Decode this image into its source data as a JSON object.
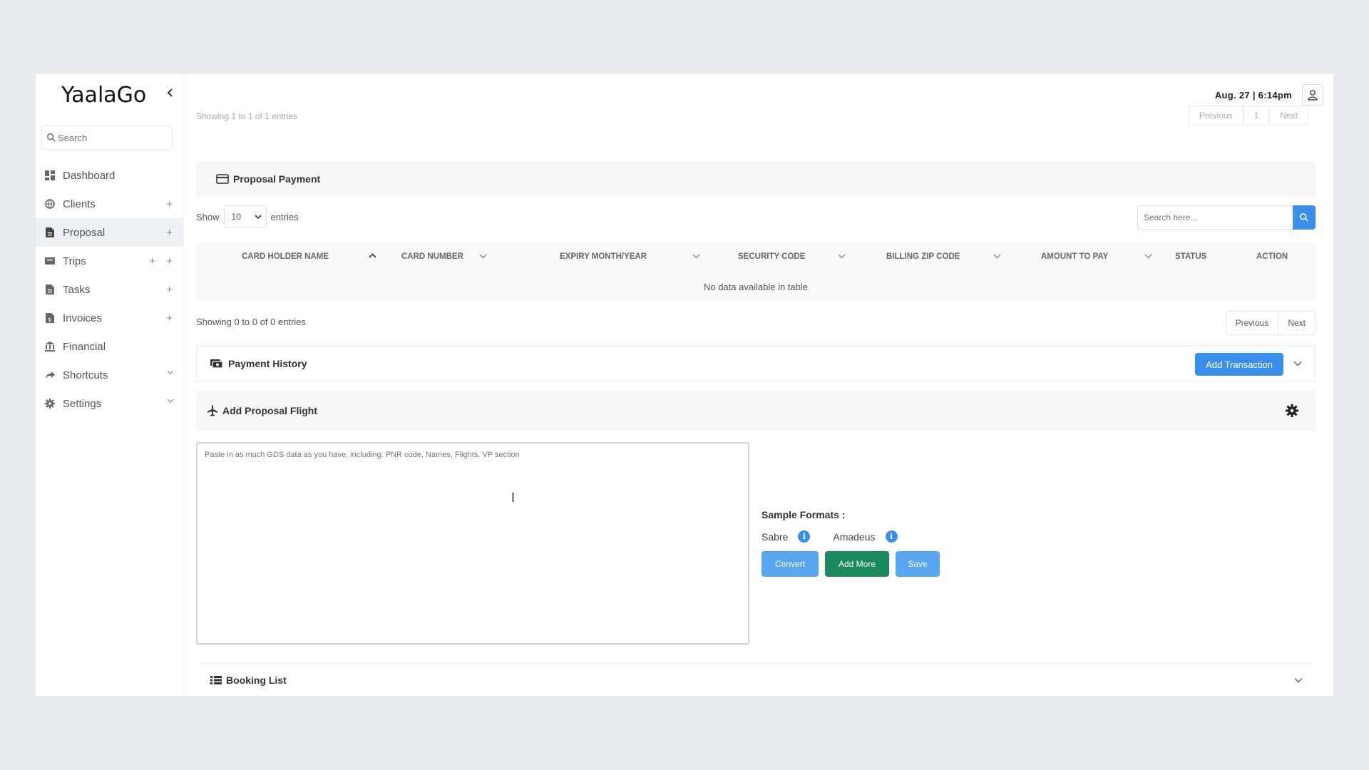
{
  "app": {
    "logo": "YaalaGo"
  },
  "sidebar": {
    "search_placeholder": "Search",
    "items": [
      {
        "label": "Dashboard"
      },
      {
        "label": "Clients"
      },
      {
        "label": "Proposal"
      },
      {
        "label": "Trips"
      },
      {
        "label": "Tasks"
      },
      {
        "label": "Invoices"
      },
      {
        "label": "Financial"
      },
      {
        "label": "Shortcuts"
      },
      {
        "label": "Settings"
      }
    ]
  },
  "header": {
    "datetime": "Aug. 27 | 6:14pm"
  },
  "ghost": {
    "showing": "Showing 1 to 1 of 1 entries",
    "previous": "Previous",
    "page": "1",
    "next": "Next"
  },
  "proposal_payment": {
    "title": "Proposal Payment",
    "show_label": "Show",
    "entries_value": "10",
    "entries_label": "entries",
    "search_placeholder": "Search here...",
    "columns": [
      "CARD HOLDER NAME",
      "CARD NUMBER",
      "EXPIRY MONTH/YEAR",
      "SECURITY CODE",
      "BILLING ZIP CODE",
      "AMOUNT TO PAY",
      "STATUS",
      "ACTION"
    ],
    "empty_text": "No data available in table",
    "showing": "Showing 0 to 0 of 0 entries",
    "previous": "Previous",
    "next": "Next"
  },
  "payment_history": {
    "title": "Payment History",
    "add_transaction": "Add Transaction"
  },
  "add_flight": {
    "title": "Add Proposal Flight",
    "gds_placeholder": "Paste in as much GDS data as you have, including: PNR code, Names, Flights, VP section",
    "sample_formats": "Sample Formats :",
    "sabre": "Sabre",
    "amadeus": "Amadeus",
    "convert": "Convert",
    "add_more": "Add More",
    "save": "Save"
  },
  "booking_list": {
    "title": "Booking List"
  },
  "colors": {
    "primary": "#3b8fec",
    "success": "#1a8a5c",
    "light_primary": "#58a6f0"
  }
}
